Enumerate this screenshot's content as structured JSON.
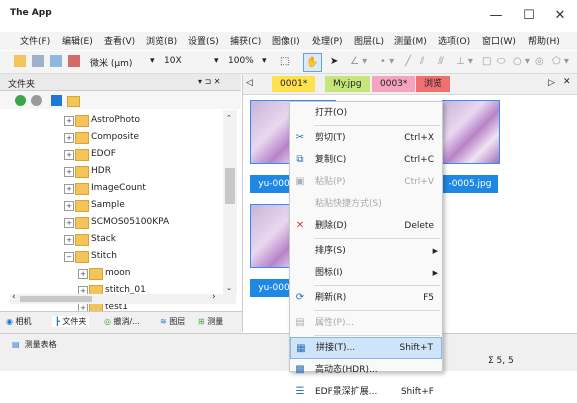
{
  "app": {
    "title": "The App"
  },
  "window": {
    "minimize": "—",
    "maximize": "☐",
    "close": "✕"
  },
  "menu": [
    "文件(F)",
    "编辑(E)",
    "查看(V)",
    "浏览(B)",
    "设置(S)",
    "捕获(C)",
    "图像(I)",
    "处理(P)",
    "图层(L)",
    "测量(M)",
    "选项(O)",
    "窗口(W)",
    "帮助(H)"
  ],
  "toolbar": {
    "unit": "微米 (µm)",
    "objective": "10X",
    "zoom": "100%"
  },
  "panel": {
    "title": "文件夹",
    "pin": "▾ ⊐ ✕"
  },
  "tree": [
    {
      "label": "AstroPhoto",
      "indent": 0
    },
    {
      "label": "Composite",
      "indent": 0
    },
    {
      "label": "EDOF",
      "indent": 0
    },
    {
      "label": "HDR",
      "indent": 0
    },
    {
      "label": "ImageCount",
      "indent": 0
    },
    {
      "label": "Sample",
      "indent": 0
    },
    {
      "label": "SCMOS05100KPA",
      "indent": 0
    },
    {
      "label": "Stack",
      "indent": 0
    },
    {
      "label": "Stitch",
      "indent": 0,
      "expanded": true
    },
    {
      "label": "moon",
      "indent": 1
    },
    {
      "label": "stitch_01",
      "indent": 1
    },
    {
      "label": "test1",
      "indent": 1
    }
  ],
  "bottom_tabs": [
    "相机",
    "文件夹",
    "撤消/...",
    "图层",
    "测量"
  ],
  "status": {
    "tab": "测量表格",
    "sum": "Σ 5, 5"
  },
  "doc_tabs": [
    {
      "label": "0001*",
      "color": "#ffe14d"
    },
    {
      "label": "My.jpg",
      "color": "#c7e67a"
    },
    {
      "label": "0003*",
      "color": "#f5a3c0"
    },
    {
      "label": "浏览",
      "color": "#f07070"
    }
  ],
  "thumbs": {
    "t1": "yu-000",
    "t2": "-0005.jpg",
    "t3": "yu-000"
  },
  "context_menu": [
    {
      "label": "打开(O)",
      "shortcut": "",
      "icon": "",
      "disabled": false
    },
    {
      "sep": true
    },
    {
      "label": "剪切(T)",
      "shortcut": "Ctrl+X",
      "icon": "✂",
      "disabled": false
    },
    {
      "label": "复制(C)",
      "shortcut": "Ctrl+C",
      "icon": "⧉",
      "disabled": false
    },
    {
      "label": "粘贴(P)",
      "shortcut": "Ctrl+V",
      "icon": "▣",
      "disabled": true
    },
    {
      "label": "粘贴快捷方式(S)",
      "shortcut": "",
      "icon": "",
      "disabled": true
    },
    {
      "label": "删除(D)",
      "shortcut": "Delete",
      "icon": "✕",
      "disabled": false
    },
    {
      "sep": true
    },
    {
      "label": "排序(S)",
      "shortcut": "",
      "icon": "",
      "disabled": false,
      "submenu": true
    },
    {
      "label": "图标(I)",
      "shortcut": "",
      "icon": "",
      "disabled": false,
      "submenu": true
    },
    {
      "sep": true
    },
    {
      "label": "刷新(R)",
      "shortcut": "F5",
      "icon": "⟳",
      "disabled": false
    },
    {
      "sep": true
    },
    {
      "label": "属性(P)...",
      "shortcut": "",
      "icon": "▤",
      "disabled": true
    },
    {
      "sep": true
    },
    {
      "label": "拼接(T)...",
      "shortcut": "Shift+T",
      "icon": "▦",
      "disabled": false,
      "highlight": true
    },
    {
      "label": "高动态(HDR)...",
      "shortcut": "",
      "icon": "▩",
      "disabled": false
    },
    {
      "label": "EDF景深扩展...",
      "shortcut": "Shift+F",
      "icon": "☰",
      "disabled": false
    }
  ]
}
